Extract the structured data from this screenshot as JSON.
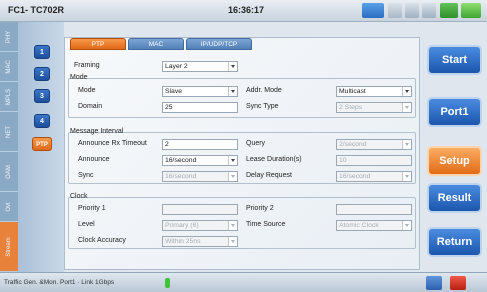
{
  "title": {
    "device": "FC1- TC702R",
    "time": "16:36:17"
  },
  "side_tabs": [
    "PHY",
    "MAC",
    "MPLS",
    "NET",
    "OAM",
    "Ovt",
    "Stream"
  ],
  "side_active": "Stream",
  "sub_tabs": [
    "1",
    "2",
    "3",
    "4",
    "PTP"
  ],
  "sub_active": "PTP",
  "panel_tabs": [
    "PTP",
    "MAC",
    "IP/UDP/TCP"
  ],
  "panel_active": "PTP",
  "framing": {
    "label": "Framing",
    "value": "Layer 2"
  },
  "mode": {
    "title": "Mode",
    "mode_label": "Mode",
    "mode_value": "Slave",
    "addr_label": "Addr. Mode",
    "addr_value": "Multicast",
    "domain_label": "Domain",
    "domain_value": "25",
    "sync_type_label": "Sync Type",
    "sync_type_value": "2 Steps"
  },
  "message_interval": {
    "title": "Message Interval",
    "announce_rx_label": "Announce Rx Timeout",
    "announce_rx_value": "2",
    "query_label": "Query",
    "query_value": "2/second",
    "announce_label": "Announce",
    "announce_value": "16/second",
    "lease_label": "Lease Duration(s)",
    "lease_value": "10",
    "sync_label": "Sync",
    "sync_value": "16/second",
    "delay_label": "Delay Request",
    "delay_value": "16/second"
  },
  "clock": {
    "title": "Clock",
    "priority1_label": "Priority 1",
    "priority1_value": "",
    "priority2_label": "Priority 2",
    "priority2_value": "",
    "level_label": "Level",
    "level_value": "Primary (6)",
    "time_source_label": "Time Source",
    "time_source_value": "Atomic Clock",
    "accuracy_label": "Clock Accuracy",
    "accuracy_value": "Within 25ns"
  },
  "buttons": [
    "Start",
    "Port1",
    "Setup",
    "Result",
    "Return"
  ],
  "active_button": "Setup",
  "status": {
    "text": "Traffic Gen. &Mon. Port1 · Link 1Gbps"
  },
  "colors": {
    "accent_orange": "#e8823a",
    "button_blue": "#1c56ad"
  }
}
